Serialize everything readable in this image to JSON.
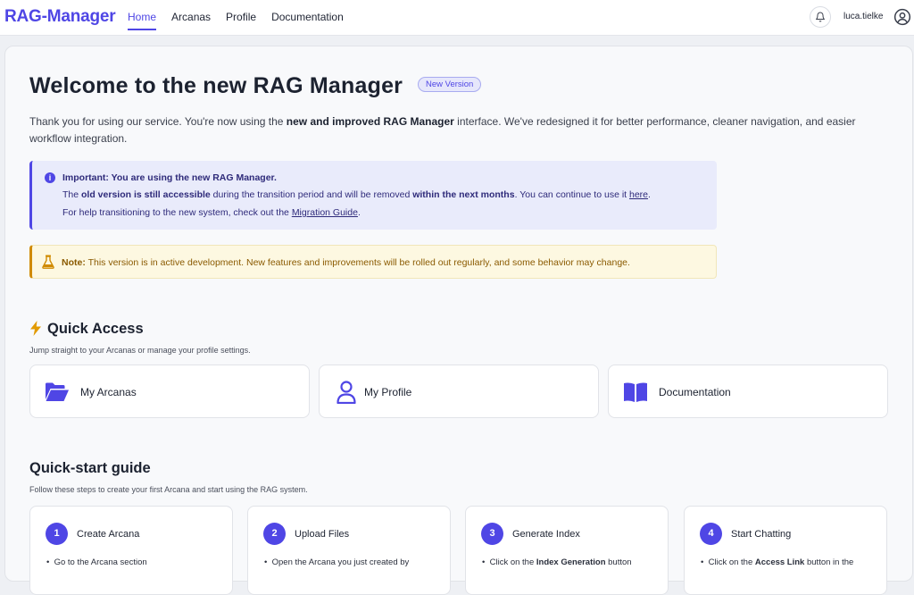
{
  "app": {
    "brand": "RAG-Manager"
  },
  "nav": {
    "items": [
      {
        "label": "Home",
        "active": true
      },
      {
        "label": "Arcanas",
        "active": false
      },
      {
        "label": "Profile",
        "active": false
      },
      {
        "label": "Documentation",
        "active": false
      }
    ]
  },
  "user": {
    "name": "luca.tielke"
  },
  "hero": {
    "title": "Welcome to the new RAG Manager",
    "badge": "New Version",
    "intro_1": "Thank you for using our service. You're now using the ",
    "intro_bold": "new and improved RAG Manager",
    "intro_2": " interface. We've redesigned it for better performance, cleaner navigation, and easier workflow integration."
  },
  "info": {
    "heading": "Important: You are using the new RAG Manager.",
    "l2_a": "The ",
    "l2_b": "old version is still accessible",
    "l2_c": " during the transition period and will be removed ",
    "l2_d": "within the next months",
    "l2_e": ". You can continue to use it ",
    "l2_link": "here",
    "l2_f": ".",
    "l3_a": "For help transitioning to the new system, check out the ",
    "l3_link": "Migration Guide",
    "l3_b": "."
  },
  "note": {
    "label": "Note:",
    "text": " This version is in active development. New features and improvements will be rolled out regularly, and some behavior may change."
  },
  "quick_access": {
    "title": "Quick Access",
    "subtitle": "Jump straight to your Arcanas or manage your profile settings.",
    "cards": [
      {
        "label": "My Arcanas",
        "icon": "folder-open-icon"
      },
      {
        "label": "My Profile",
        "icon": "user-icon"
      },
      {
        "label": "Documentation",
        "icon": "book-open-icon"
      }
    ]
  },
  "guide": {
    "title": "Quick-start guide",
    "subtitle": "Follow these steps to create your first Arcana and start using the RAG system.",
    "steps": [
      {
        "num": "1",
        "title": "Create Arcana",
        "bullet_a": "Go to the Arcana section",
        "bullet_bold": "",
        "bullet_b": ""
      },
      {
        "num": "2",
        "title": "Upload Files",
        "bullet_a": "Open the Arcana you just created by",
        "bullet_bold": "",
        "bullet_b": ""
      },
      {
        "num": "3",
        "title": "Generate Index",
        "bullet_a": "Click on the ",
        "bullet_bold": "Index Generation",
        "bullet_b": " button"
      },
      {
        "num": "4",
        "title": "Start Chatting",
        "bullet_a": "Click on the ",
        "bullet_bold": "Access Link",
        "bullet_b": " button in the"
      }
    ]
  },
  "colors": {
    "accent": "#4f46e5",
    "note": "#d08a00",
    "background": "#eef0f4"
  }
}
